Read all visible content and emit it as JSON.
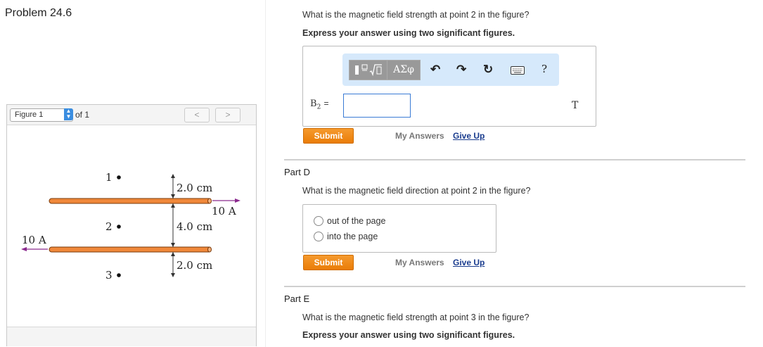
{
  "problem": {
    "title": "Problem 24.6"
  },
  "figure": {
    "select_value": "Figure 1",
    "of_label": "of 1",
    "prev_label": "<",
    "next_label": ">",
    "labels": {
      "point1": "1",
      "point2": "2",
      "point3": "3",
      "dist_top": "2.0 cm",
      "dist_mid": "4.0 cm",
      "dist_bot": "2.0 cm",
      "current_top": "10 A",
      "current_bottom": "10 A"
    },
    "colors": {
      "wire": "#f0883a",
      "arrow": "#8b2a8e"
    }
  },
  "part_c": {
    "question": "What is the magnetic field strength at point 2 in the figure?",
    "instruction": "Express your answer using two significant figures.",
    "toolbar": {
      "template_icon": "fraction-sqrt-template-icon",
      "greek_label": "ΑΣφ",
      "undo_icon": "undo-icon",
      "redo_icon": "redo-icon",
      "reset_icon": "reset-icon",
      "keyboard_icon": "keyboard-icon",
      "help_label": "?"
    },
    "variable_label": "B",
    "variable_sub": "2",
    "equals": "=",
    "answer_value": "",
    "unit": "T",
    "submit": "Submit",
    "my_answers": "My Answers",
    "give_up": "Give Up"
  },
  "part_d": {
    "label": "Part D",
    "question": "What is the magnetic field direction at point 2 in the figure?",
    "options": [
      "out of the page",
      "into the page"
    ],
    "submit": "Submit",
    "my_answers": "My Answers",
    "give_up": "Give Up"
  },
  "part_e": {
    "label": "Part E",
    "question": "What is the magnetic field strength at point 3 in the figure?",
    "instruction": "Express your answer using two significant figures."
  }
}
